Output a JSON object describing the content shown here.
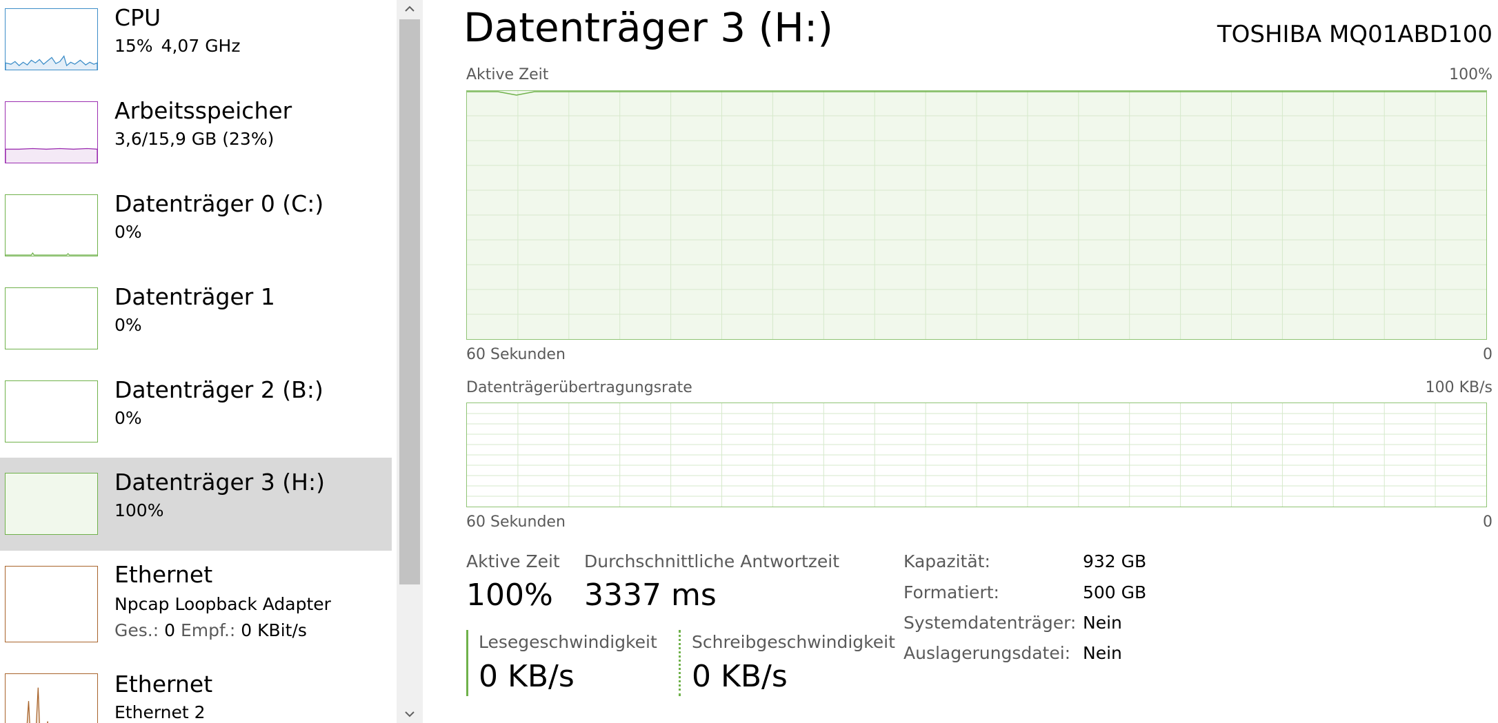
{
  "colors": {
    "cpu": "#3c8dc8",
    "memory": "#9b2db0",
    "disk": "#6fb14a",
    "ethernet": "#a8632a",
    "selected_bg": "#d9d9d9",
    "graph_fill": "#f1f8ec"
  },
  "sidebar": {
    "items": [
      {
        "title": "CPU",
        "line1": "15%",
        "line1b": "4,07 GHz"
      },
      {
        "title": "Arbeitsspeicher",
        "line1": "3,6/15,9 GB (23%)"
      },
      {
        "title": "Datenträger 0 (C:)",
        "line1": "0%"
      },
      {
        "title": "Datenträger 1",
        "line1": "0%"
      },
      {
        "title": "Datenträger 2 (B:)",
        "line1": "0%"
      },
      {
        "title": "Datenträger 3 (H:)",
        "line1": "100%",
        "selected": true
      },
      {
        "title": "Ethernet",
        "line1": "Npcap Loopback Adapter",
        "send_label": "Ges.:",
        "send_value": "0",
        "recv_label": "Empf.:",
        "recv_value": "0 KBit/s"
      },
      {
        "title": "Ethernet",
        "line1": "Ethernet 2"
      }
    ],
    "scroll_up_icon": "chevron-up-icon",
    "scroll_down_icon": "chevron-down-icon"
  },
  "main": {
    "title": "Datenträger 3 (H:)",
    "model": "TOSHIBA MQ01ABD100",
    "active_graph": {
      "label": "Aktive Zeit",
      "max_label": "100%",
      "time_label": "60 Sekunden",
      "min_label": "0",
      "level_percent": 100
    },
    "transfer_graph": {
      "label": "Datenträgerübertragungsrate",
      "max_label": "100 KB/s",
      "time_label": "60 Sekunden",
      "min_label": "0",
      "level_percent": 0
    },
    "stats": {
      "active_time_label": "Aktive Zeit",
      "active_time_value": "100%",
      "response_label": "Durchschnittliche Antwortzeit",
      "response_value": "3337 ms",
      "read_label": "Lesegeschwindigkeit",
      "read_value": "0 KB/s",
      "write_label": "Schreibgeschwindigkeit",
      "write_value": "0 KB/s"
    },
    "properties": [
      {
        "key": "Kapazität:",
        "value": "932 GB"
      },
      {
        "key": "Formatiert:",
        "value": "500 GB"
      },
      {
        "key": "Systemdatenträger:",
        "value": "Nein"
      },
      {
        "key": "Auslagerungsdatei:",
        "value": "Nein"
      }
    ]
  }
}
